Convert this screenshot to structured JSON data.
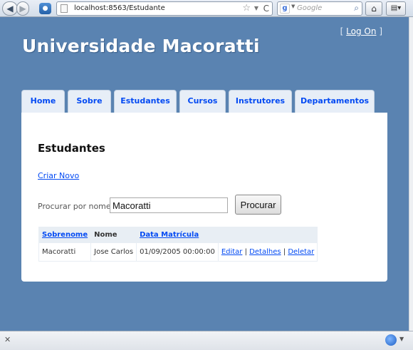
{
  "browser": {
    "url": "localhost:8563/Estudante",
    "search_placeholder": "Google",
    "search_engine_glyph": "g",
    "back_glyph": "◀",
    "forward_glyph": "▶",
    "star_glyph": "☆",
    "reload_glyph": "C",
    "magnifier_glyph": "⌕",
    "home_glyph": "⌂",
    "tools_glyph": "▤▾",
    "status_close_glyph": "✕",
    "dropdown_glyph": "▼"
  },
  "header": {
    "logon_left": "[",
    "logon_label": "Log On",
    "logon_right": "]",
    "site_title": "Universidade Macoratti"
  },
  "nav": {
    "tabs": [
      {
        "label": "Home"
      },
      {
        "label": "Sobre"
      },
      {
        "label": "Estudantes"
      },
      {
        "label": "Cursos"
      },
      {
        "label": "Instrutores"
      },
      {
        "label": "Departamentos"
      }
    ]
  },
  "main": {
    "heading": "Estudantes",
    "create_link": "Criar Novo",
    "search_label": "Procurar por nome:",
    "search_value": "Macoratti",
    "search_button": "Procurar",
    "table": {
      "headers": [
        "Sobrenome",
        "Nome",
        "Data Matrícula",
        ""
      ],
      "rows": [
        {
          "sobrenome": "Macoratti",
          "nome": "Jose Carlos",
          "data": "01/09/2005 00:00:00",
          "edit": "Editar",
          "details": "Detalhes",
          "delete": "Deletar",
          "sep": "|"
        }
      ]
    }
  },
  "colors": {
    "page_bg": "#5a83b1",
    "link": "#034af3",
    "tab_bg": "#e7eef7",
    "table_header_bg": "#e8eef4"
  }
}
